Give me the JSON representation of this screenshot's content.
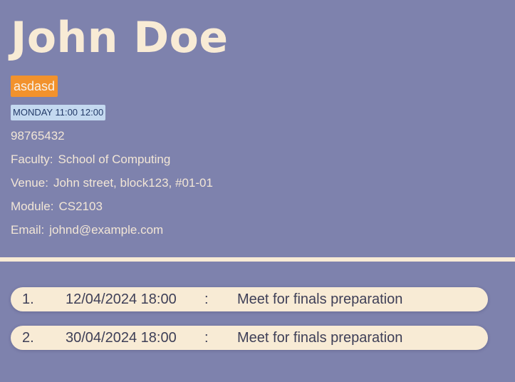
{
  "person": {
    "name": "John Doe",
    "tag": "asdasd",
    "schedule": "MONDAY 11:00 12:00",
    "phone": "98765432",
    "faculty": {
      "label": "Faculty:",
      "value": "School of Computing"
    },
    "venue": {
      "label": "Venue:",
      "value": "John street, block123, #01-01"
    },
    "module": {
      "label": "Module:",
      "value": "CS2103"
    },
    "email": {
      "label": "Email:",
      "value": "johnd@example.com"
    }
  },
  "events": [
    {
      "index": "1.",
      "datetime": "12/04/2024 18:00",
      "separator": ":",
      "description": "Meet for finals preparation"
    },
    {
      "index": "2.",
      "datetime": "30/04/2024 18:00",
      "separator": ":",
      "description": "Meet for finals preparation"
    }
  ],
  "colors": {
    "background": "#7e82ad",
    "cream": "#f8ebd5",
    "tag": "#f2922c",
    "schedule": "#c4d9f0"
  }
}
